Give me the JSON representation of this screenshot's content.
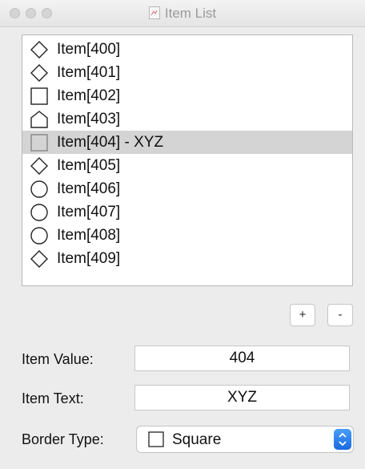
{
  "window": {
    "title": "Item List"
  },
  "list": {
    "items": [
      {
        "label": "Item[400]",
        "shape": "diamond-icon",
        "selected": false
      },
      {
        "label": "Item[401]",
        "shape": "diamond-icon",
        "selected": false
      },
      {
        "label": "Item[402]",
        "shape": "square-icon",
        "selected": false
      },
      {
        "label": "Item[403]",
        "shape": "pentagon-icon",
        "selected": false
      },
      {
        "label": "Item[404] - XYZ",
        "shape": "square-icon",
        "selected": true
      },
      {
        "label": "Item[405]",
        "shape": "diamond-icon",
        "selected": false
      },
      {
        "label": "Item[406]",
        "shape": "circle-icon",
        "selected": false
      },
      {
        "label": "Item[407]",
        "shape": "circle-icon",
        "selected": false
      },
      {
        "label": "Item[408]",
        "shape": "circle-icon",
        "selected": false
      },
      {
        "label": "Item[409]",
        "shape": "diamond-icon",
        "selected": false
      }
    ]
  },
  "buttons": {
    "add_label": "+",
    "remove_label": "-"
  },
  "form": {
    "item_value_label": "Item Value:",
    "item_value": "404",
    "item_text_label": "Item Text:",
    "item_text": "XYZ",
    "border_type_label": "Border Type:",
    "border_type_value": "Square",
    "border_type_icon": "square-icon"
  },
  "colors": {
    "selection": "#d4d4d4",
    "accent": "#1a73e8"
  }
}
